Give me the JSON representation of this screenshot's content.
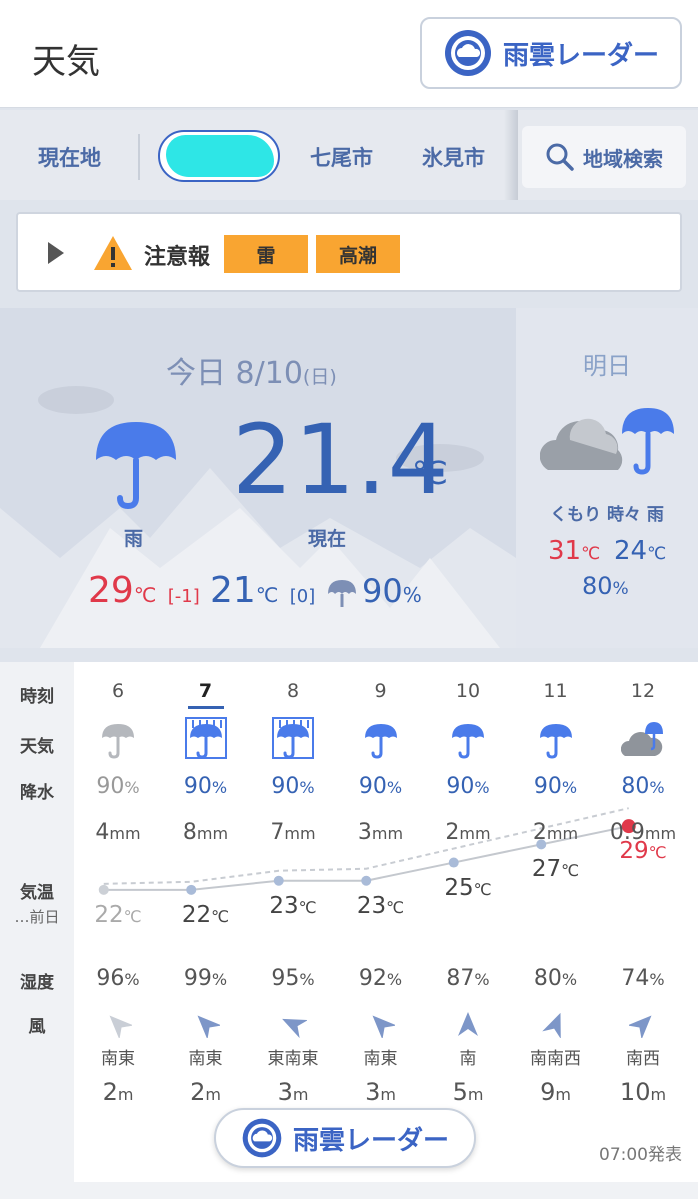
{
  "header": {
    "title": "天気",
    "radar_label": "雨雲レーダー"
  },
  "locations": {
    "current": "現在地",
    "items": [
      "七尾市",
      "氷見市"
    ],
    "search_label": "地域検索"
  },
  "warning": {
    "title": "注意報",
    "tags": [
      "雷",
      "高潮"
    ]
  },
  "today": {
    "date": "今日 8/10",
    "weekday": "(日)",
    "temp_now": "21.4",
    "temp_unit": "℃",
    "weather": "雨",
    "now_label": "現在",
    "high": "29",
    "high_diff": "[-1]",
    "low": "21",
    "low_diff": "[0]",
    "unit": "℃",
    "rain_pct": "90",
    "pct": "%"
  },
  "tomorrow": {
    "title": "明日",
    "weather": "くもり 時々 雨",
    "high": "31",
    "low": "24",
    "unit": "℃",
    "rain_pct": "80",
    "pct": "%"
  },
  "hourly_labels": {
    "time": "時刻",
    "weather": "天気",
    "precip": "降水",
    "temp": "気温",
    "prev_day": "…前日",
    "humidity": "湿度",
    "wind": "風"
  },
  "hourly": [
    {
      "time": "6",
      "icon": "umbrella-gray-icon",
      "rain": "90",
      "mm": "4",
      "temp": "22",
      "hum": "96",
      "dir": "南東",
      "speed": "2"
    },
    {
      "time": "7",
      "icon": "heavy-rain-umbrella-icon",
      "rain": "90",
      "mm": "8",
      "temp": "22",
      "hum": "99",
      "dir": "南東",
      "speed": "2"
    },
    {
      "time": "8",
      "icon": "heavy-rain-umbrella-icon",
      "rain": "90",
      "mm": "7",
      "temp": "23",
      "hum": "95",
      "dir": "東南東",
      "speed": "3"
    },
    {
      "time": "9",
      "icon": "umbrella-icon",
      "rain": "90",
      "mm": "3",
      "temp": "23",
      "hum": "92",
      "dir": "南東",
      "speed": "3"
    },
    {
      "time": "10",
      "icon": "umbrella-icon",
      "rain": "90",
      "mm": "2",
      "temp": "25",
      "hum": "87",
      "dir": "南",
      "speed": "5"
    },
    {
      "time": "11",
      "icon": "umbrella-icon",
      "rain": "90",
      "mm": "2",
      "temp": "27",
      "hum": "80",
      "dir": "南南西",
      "speed": "9"
    },
    {
      "time": "12",
      "icon": "cloud-umbrella-icon",
      "rain": "80",
      "mm": "0.9",
      "temp": "29",
      "hum": "74",
      "dir": "南西",
      "speed": "10"
    }
  ],
  "units": {
    "pct": "%",
    "mm": "mm",
    "c": "℃",
    "m": "m"
  },
  "issued": "07:00発表",
  "colors": {
    "accent": "#3562b3",
    "high": "#e0394a",
    "warning": "#f9a531",
    "rain_icon": "#4a7bea"
  }
}
